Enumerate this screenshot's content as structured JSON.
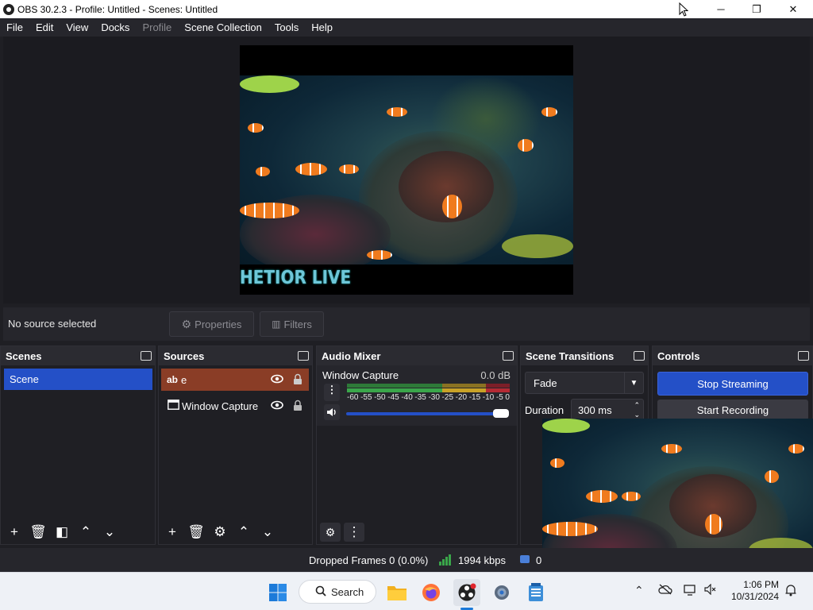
{
  "window": {
    "title": "OBS 30.2.3 - Profile: Untitled - Scenes: Untitled",
    "minimize": "─",
    "maximize": "❐",
    "close": "✕"
  },
  "menu": [
    "File",
    "Edit",
    "View",
    "Docks",
    "Profile",
    "Scene Collection",
    "Tools",
    "Help"
  ],
  "preview": {
    "overlay_text": "HETIOR LIVE"
  },
  "source_toolbar": {
    "status": "No source selected",
    "properties_label": "Properties",
    "filters_label": "Filters"
  },
  "docks": {
    "scenes": {
      "title": "Scenes",
      "items": [
        "Scene"
      ]
    },
    "sources": {
      "title": "Sources",
      "items": [
        {
          "label": "e",
          "type_icon": "ab"
        },
        {
          "label": "Window Capture",
          "type_icon": "window-icon"
        }
      ]
    },
    "mixer": {
      "title": "Audio Mixer",
      "channel": "Window Capture",
      "level": "0.0 dB",
      "ticks": [
        "-60",
        "-55",
        "-50",
        "-45",
        "-40",
        "-35",
        "-30",
        "-25",
        "-20",
        "-15",
        "-10",
        "-5",
        "0"
      ]
    },
    "transitions": {
      "title": "Scene Transitions",
      "selected": "Fade",
      "duration_label": "Duration",
      "duration_value": "300 ms"
    },
    "controls": {
      "title": "Controls",
      "stop_streaming": "Stop Streaming",
      "start_recording": "Start Recording"
    }
  },
  "status": {
    "dropped": "Dropped Frames 0 (0.0%)",
    "bitrate": "1994 kbps",
    "extra": "0"
  },
  "taskbar": {
    "search_label": "Search",
    "time": "1:06 PM",
    "date": "10/31/2024"
  },
  "colors": {
    "accent": "#2450c7",
    "source_selected": "#8a3d26",
    "meter_green": "#3aa64a",
    "meter_yellow": "#c9a227",
    "meter_red": "#b52a34"
  }
}
